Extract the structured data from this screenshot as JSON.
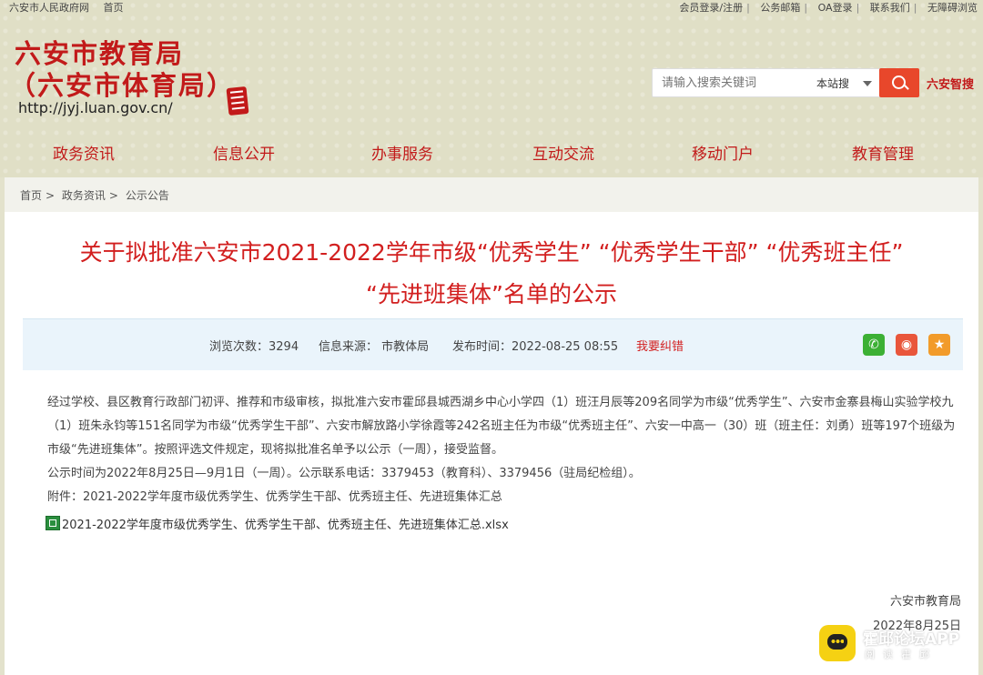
{
  "topbar": {
    "left": [
      "六安市人民政府网",
      "首页"
    ],
    "right": [
      "会员登录/注册",
      "公务邮箱",
      "OA登录",
      "联系我们",
      "无障碍浏览"
    ]
  },
  "header": {
    "logo_line1": "六安市教育局",
    "logo_line2": "（六安市体育局）",
    "url": "http://jyj.luan.gov.cn/",
    "search_placeholder": "请输入搜索关键词",
    "search_scope": "本站搜",
    "zhigang": "六安智搜"
  },
  "nav": [
    "政务资讯",
    "信息公开",
    "办事服务",
    "互动交流",
    "移动门户",
    "教育管理"
  ],
  "breadcrumb": [
    "首页",
    "政务资讯",
    "公示公告"
  ],
  "article": {
    "title_line1": "关于拟批准六安市2021-2022学年市级“优秀学生” “优秀学生干部” “优秀班主任”",
    "title_line2": "“先进班集体”名单的公示",
    "views": "浏览次数：3294",
    "source": "信息来源：  市教体局",
    "publish_time": "发布时间：2022-08-25 08:55",
    "correct_link": "我要纠错",
    "para1": "经过学校、县区教育行政部门初评、推荐和市级审核，拟批准六安市霍邱县城西湖乡中心小学四（1）班汪月辰等209名同学为市级“优秀学生”、六安市金寨县梅山实验学校九（1）班朱永钧等151名同学为市级“优秀学生干部”、六安市解放路小学徐霞等242名班主任为市级“优秀班主任”、六安一中高一（30）班（班主任：刘勇）班等197个班级为市级“先进班集体”。按照评选文件规定，现将拟批准名单予以公示（一周），接受监督。",
    "para2": "公示时间为2022年8月25日—9月1日（一周）。公示联系电话：3379453（教育科）、3379456（驻局纪检组）。",
    "para3": "附件：2021-2022学年度市级优秀学生、优秀学生干部、优秀班主任、先进班集体汇总",
    "attachment_file": "2021-2022学年度市级优秀学生、优秀学生干部、优秀班主任、先进班集体汇总.xlsx",
    "signature": "六安市教育局",
    "date": "2022年8月25日"
  },
  "share_icons": [
    "wechat-icon",
    "weibo-icon",
    "star-icon"
  ],
  "watermark": {
    "title": "霍邱论坛APP",
    "subtitle": "阅读霍邱"
  },
  "colors": {
    "accent_red": "#c21a1a",
    "search_button": "#e8472b",
    "info_bar": "#eaf4fb"
  }
}
